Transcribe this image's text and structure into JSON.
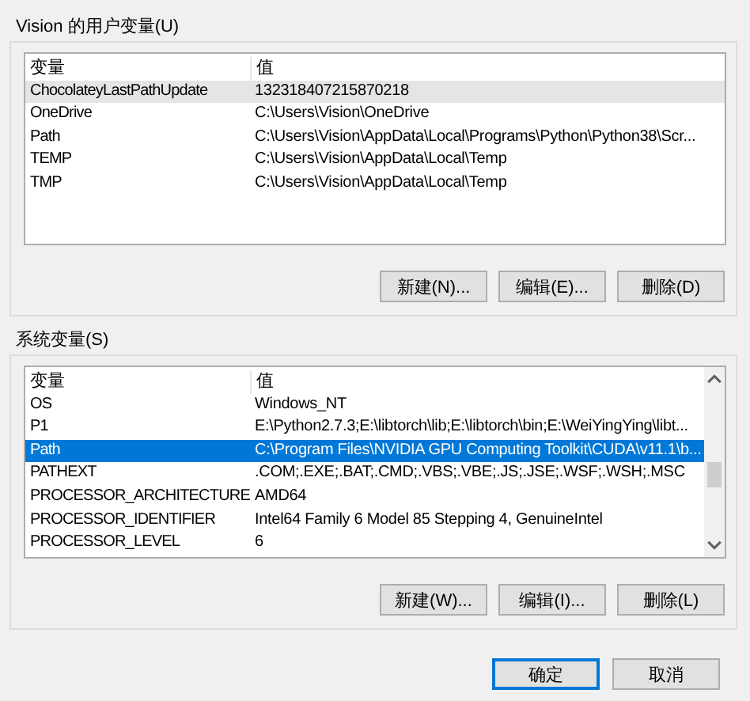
{
  "user_variables": {
    "title": "Vision 的用户变量(U)",
    "columns": [
      "变量",
      "值"
    ],
    "scrollbar": false,
    "rows": [
      {
        "name": "ChocolateyLastPathUpdate",
        "value": "132318407215870218",
        "selected": false,
        "hovered": true
      },
      {
        "name": "OneDrive",
        "value": "C:\\Users\\Vision\\OneDrive",
        "selected": false,
        "hovered": false
      },
      {
        "name": "Path",
        "value": "C:\\Users\\Vision\\AppData\\Local\\Programs\\Python\\Python38\\Scr...",
        "selected": false,
        "hovered": false
      },
      {
        "name": "TEMP",
        "value": "C:\\Users\\Vision\\AppData\\Local\\Temp",
        "selected": false,
        "hovered": false
      },
      {
        "name": "TMP",
        "value": "C:\\Users\\Vision\\AppData\\Local\\Temp",
        "selected": false,
        "hovered": false
      }
    ],
    "buttons": [
      "新建(N)...",
      "编辑(E)...",
      "删除(D)"
    ]
  },
  "system_variables": {
    "title": "系统变量(S)",
    "columns": [
      "变量",
      "值"
    ],
    "scrollbar": true,
    "rows": [
      {
        "name": "OS",
        "value": "Windows_NT",
        "selected": false,
        "hovered": false
      },
      {
        "name": "P1",
        "value": "E:\\Python2.7.3;E:\\libtorch\\lib;E:\\libtorch\\bin;E:\\WeiYingYing\\libt...",
        "selected": false,
        "hovered": false
      },
      {
        "name": "Path",
        "value": "C:\\Program Files\\NVIDIA GPU Computing Toolkit\\CUDA\\v11.1\\b...",
        "selected": true,
        "hovered": false
      },
      {
        "name": "PATHEXT",
        "value": ".COM;.EXE;.BAT;.CMD;.VBS;.VBE;.JS;.JSE;.WSF;.WSH;.MSC",
        "selected": false,
        "hovered": false
      },
      {
        "name": "PROCESSOR_ARCHITECTURE",
        "value": "AMD64",
        "selected": false,
        "hovered": false
      },
      {
        "name": "PROCESSOR_IDENTIFIER",
        "value": "Intel64 Family 6 Model 85 Stepping 4, GenuineIntel",
        "selected": false,
        "hovered": false
      },
      {
        "name": "PROCESSOR_LEVEL",
        "value": "6",
        "selected": false,
        "hovered": false
      }
    ],
    "buttons": [
      "新建(W)...",
      "编辑(I)...",
      "删除(L)"
    ]
  },
  "dialog_buttons": [
    {
      "label": "确定",
      "default": true
    },
    {
      "label": "取消",
      "default": false
    }
  ]
}
